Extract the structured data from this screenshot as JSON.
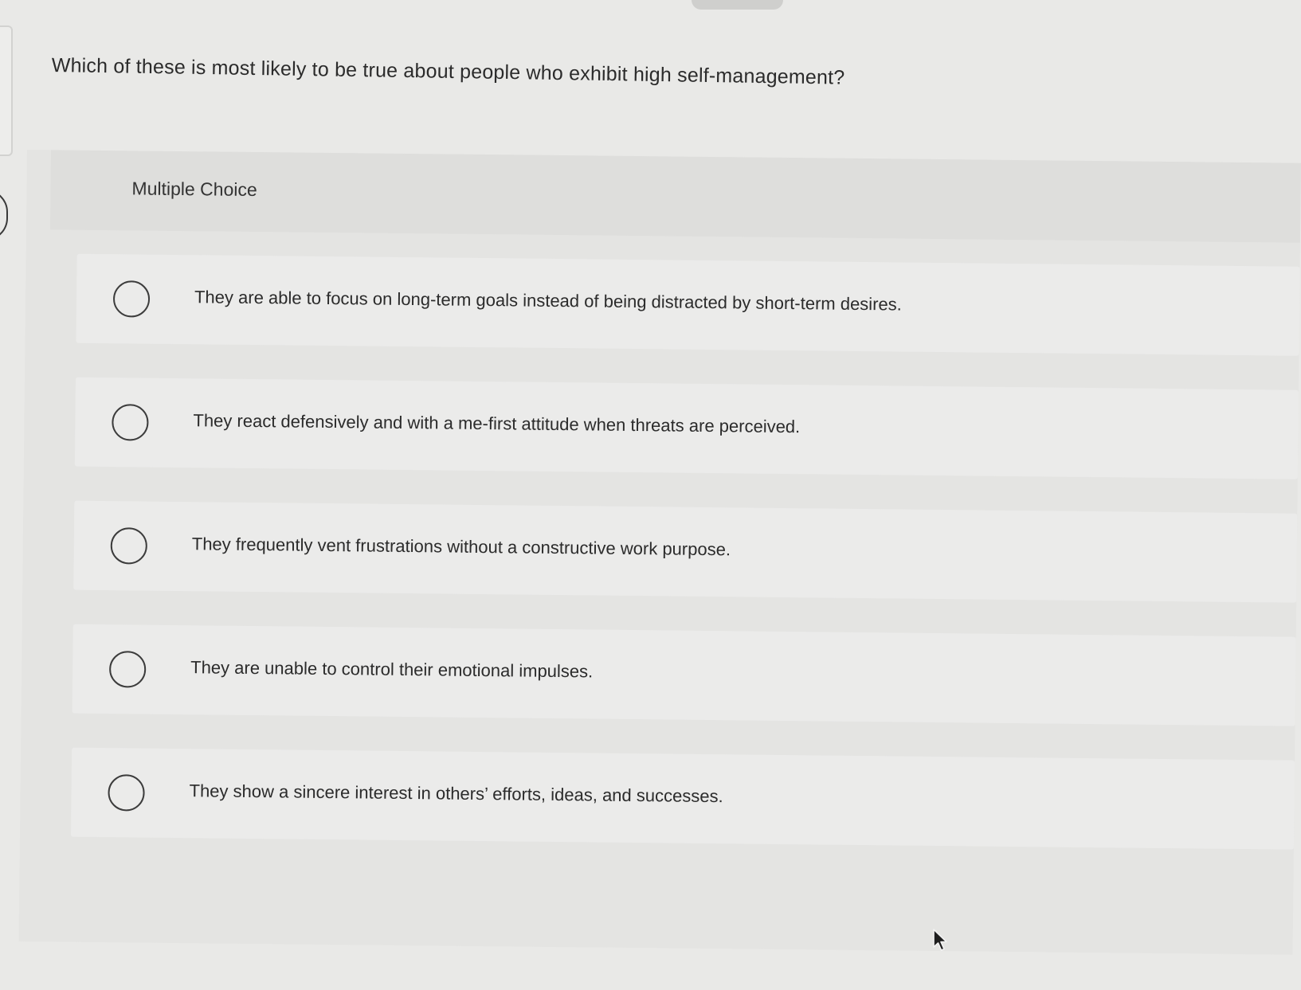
{
  "question": {
    "text": "Which of these is most likely to be true about people who exhibit high self-management?"
  },
  "multiple_choice": {
    "label": "Multiple Choice",
    "options": [
      {
        "label": "They are able to focus on long-term goals instead of being distracted by short-term desires.",
        "selected": false
      },
      {
        "label": "They react defensively and with a me-first attitude when threats are perceived.",
        "selected": false
      },
      {
        "label": "They frequently vent frustrations without a constructive work purpose.",
        "selected": false
      },
      {
        "label": "They are unable to control their emotional impulses.",
        "selected": false
      },
      {
        "label": "They show a sincere interest in others’ efforts, ideas, and successes.",
        "selected": false
      }
    ]
  },
  "icons": {
    "cursor": "mouse-pointer-icon",
    "radio": "radio-unchecked-icon"
  }
}
